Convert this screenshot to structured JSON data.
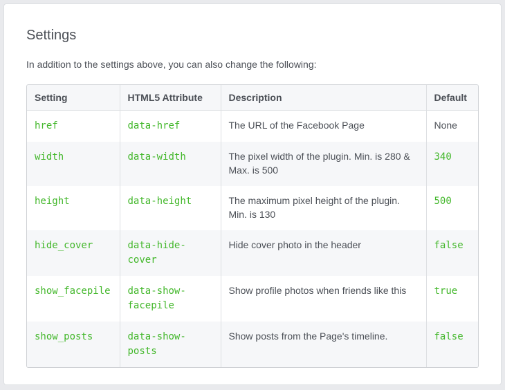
{
  "page": {
    "title": "Settings",
    "intro": "In addition to the settings above, you can also change the following:"
  },
  "table": {
    "headers": {
      "setting": "Setting",
      "attribute": "HTML5 Attribute",
      "description": "Description",
      "default": "Default"
    },
    "rows": [
      {
        "setting": "href",
        "attribute": "data-href",
        "description": "The URL of the Facebook Page",
        "default": "None",
        "default_is_code": false
      },
      {
        "setting": "width",
        "attribute": "data-width",
        "description": "The pixel width of the plugin. Min. is 280 & Max. is 500",
        "default": "340",
        "default_is_code": true
      },
      {
        "setting": "height",
        "attribute": "data-height",
        "description": "The maximum pixel height of the plugin. Min. is 130",
        "default": "500",
        "default_is_code": true
      },
      {
        "setting": "hide_cover",
        "attribute": "data-hide-cover",
        "description": "Hide cover photo in the header",
        "default": "false",
        "default_is_code": true
      },
      {
        "setting": "show_facepile",
        "attribute": "data-show-facepile",
        "description": "Show profile photos when friends like this",
        "default": "true",
        "default_is_code": true
      },
      {
        "setting": "show_posts",
        "attribute": "data-show-posts",
        "description": "Show posts from the Page's timeline.",
        "default": "false",
        "default_is_code": true
      }
    ]
  },
  "colors": {
    "code": "#42b72a",
    "text": "#4b4f56",
    "stripe": "#f6f7f9",
    "border": "#dddfe2"
  }
}
